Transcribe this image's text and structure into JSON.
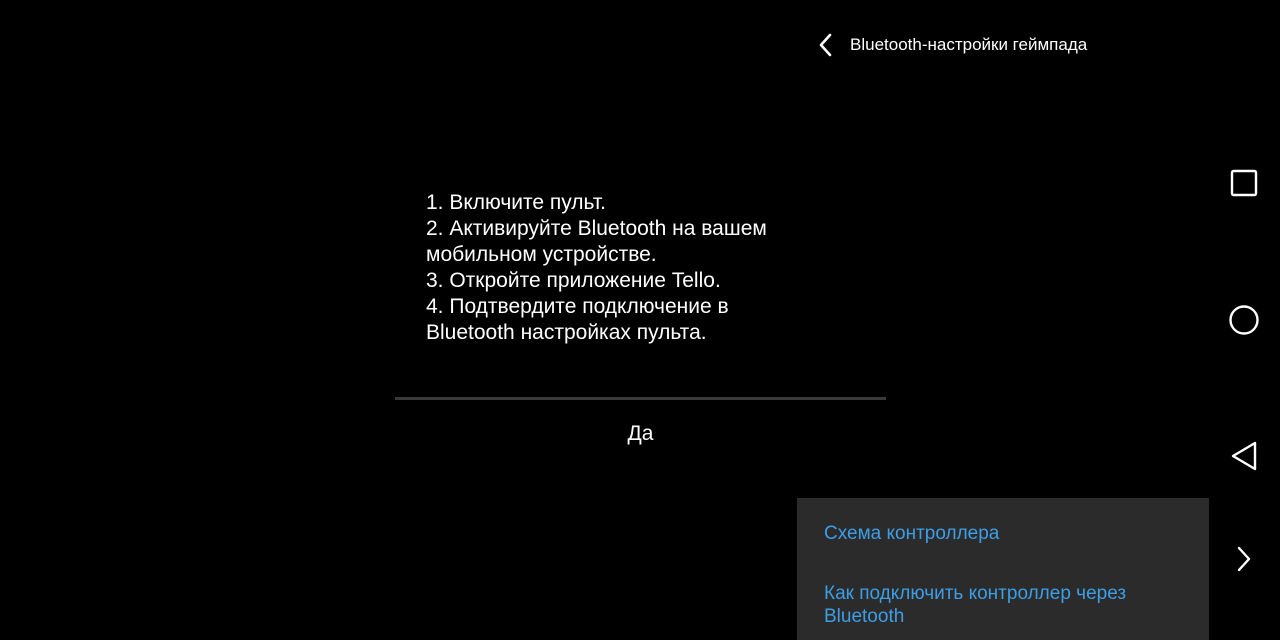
{
  "header": {
    "back_icon": "chevron-left-icon",
    "title": "Bluetooth-настройки геймпада"
  },
  "dialog": {
    "instructions": [
      "1. Включите пульт.",
      "2. Активируйте Bluetooth на вашем",
      "мобильном устройстве.",
      "3. Откройте приложение Tello.",
      "4. Подтвердите подключение в",
      "Bluetooth настройках пульта."
    ],
    "confirm_label": "Да"
  },
  "popup_menu": {
    "items": [
      "Схема контроллера",
      "Как подключить контроллер через Bluetooth"
    ],
    "background": "#2b2b2b",
    "link_color": "#3d9ee6"
  },
  "navbar": {
    "icons": [
      "square-recents-icon",
      "circle-home-icon",
      "triangle-back-icon",
      "chevron-right-icon"
    ]
  },
  "colors": {
    "background": "#000000",
    "text": "#ffffff",
    "divider": "#3a3a3a"
  }
}
